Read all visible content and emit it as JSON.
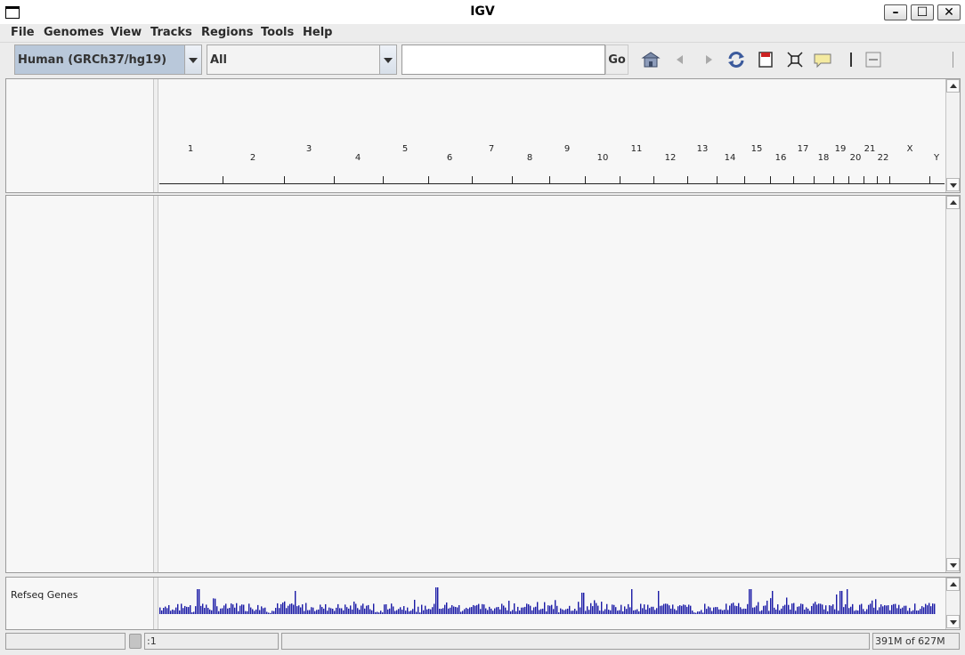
{
  "window": {
    "title": "IGV"
  },
  "menu": [
    "File",
    "Genomes",
    "View",
    "Tracks",
    "Regions",
    "Tools",
    "Help"
  ],
  "toolbar": {
    "genome": "Human (GRCh37/hg19)",
    "chromosome": "All",
    "locus_value": "",
    "go_label": "Go",
    "icons": [
      "home-icon",
      "back-icon",
      "forward-icon",
      "refresh-icon",
      "roi-icon",
      "resize-icon",
      "popup-text-icon",
      "ruler-icon",
      "zoom-out-icon"
    ]
  },
  "ruler": {
    "chromosomes": [
      "1",
      "2",
      "3",
      "4",
      "5",
      "6",
      "7",
      "8",
      "9",
      "10",
      "11",
      "12",
      "13",
      "14",
      "15",
      "16",
      "17",
      "18",
      "19",
      "20",
      "21",
      "22",
      "X",
      "Y"
    ]
  },
  "tracks": {
    "feature_track_name": "Refseq Genes"
  },
  "status": {
    "left": "",
    "position": ":1",
    "message": "",
    "memory": "391M of 627M"
  },
  "colors": {
    "gene_density": "#1a1aa6",
    "panel_bg": "#f7f7f7"
  }
}
